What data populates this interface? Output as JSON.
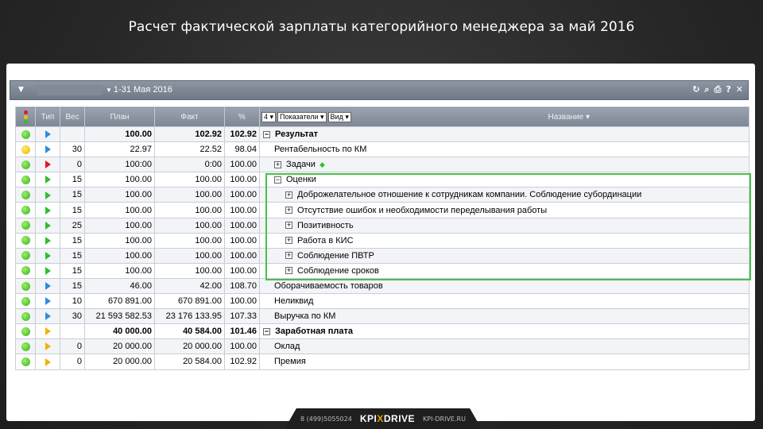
{
  "title": "Расчет фактической зарплаты категорийного менеджера за май 2016",
  "toolbar": {
    "dropdown_icon": "chevron-down-icon",
    "period_arrow": "▼",
    "period": "1-31 Мая 2016",
    "icons": [
      "refresh-icon",
      "search-icon",
      "print-icon",
      "help-icon",
      "close-icon"
    ]
  },
  "columns": {
    "type": "Тип",
    "weight": "Вес",
    "plan": "План",
    "fact": "Факт",
    "percent": "%",
    "levels": "4",
    "indicators": "Показатели",
    "view": "Вид",
    "name": "Название"
  },
  "rows": [
    {
      "light": "green",
      "type": "blue",
      "weight": "",
      "plan": "100.00",
      "fact": "102.92",
      "percent": "102.92",
      "name": "Результат",
      "indent": 0,
      "expander": "⊟",
      "bold": true
    },
    {
      "light": "yellow",
      "type": "blue",
      "weight": "30",
      "plan": "22.97",
      "fact": "22.52",
      "percent": "98.04",
      "name": "Рентабельность по КМ",
      "indent": 1,
      "expander": "",
      "bold": false
    },
    {
      "light": "green",
      "type": "red",
      "weight": "0",
      "plan": "100:00",
      "fact": "0:00",
      "percent": "100.00",
      "name": "Задачи",
      "indent": 1,
      "expander": "⊞",
      "bold": false,
      "diamond": true
    },
    {
      "light": "green",
      "type": "green",
      "weight": "15",
      "plan": "100.00",
      "fact": "100.00",
      "percent": "100.00",
      "name": "Оценки",
      "indent": 1,
      "expander": "⊟",
      "bold": false
    },
    {
      "light": "green",
      "type": "green",
      "weight": "15",
      "plan": "100.00",
      "fact": "100.00",
      "percent": "100.00",
      "name": "Доброжелательное отношение к сотрудникам компании. Соблюдение субординации",
      "indent": 2,
      "expander": "⊞",
      "bold": false
    },
    {
      "light": "green",
      "type": "green",
      "weight": "15",
      "plan": "100.00",
      "fact": "100.00",
      "percent": "100.00",
      "name": "Отсутствие ошибок и необходимости переделывания работы",
      "indent": 2,
      "expander": "⊞",
      "bold": false
    },
    {
      "light": "green",
      "type": "green",
      "weight": "25",
      "plan": "100.00",
      "fact": "100.00",
      "percent": "100.00",
      "name": "Позитивность",
      "indent": 2,
      "expander": "⊞",
      "bold": false
    },
    {
      "light": "green",
      "type": "green",
      "weight": "15",
      "plan": "100.00",
      "fact": "100.00",
      "percent": "100.00",
      "name": "Работа в КИС",
      "indent": 2,
      "expander": "⊞",
      "bold": false
    },
    {
      "light": "green",
      "type": "green",
      "weight": "15",
      "plan": "100.00",
      "fact": "100.00",
      "percent": "100.00",
      "name": "Соблюдение ПВТР",
      "indent": 2,
      "expander": "⊞",
      "bold": false
    },
    {
      "light": "green",
      "type": "green",
      "weight": "15",
      "plan": "100.00",
      "fact": "100.00",
      "percent": "100.00",
      "name": "Соблюдение сроков",
      "indent": 2,
      "expander": "⊞",
      "bold": false
    },
    {
      "light": "green",
      "type": "blue",
      "weight": "15",
      "plan": "46.00",
      "fact": "42.00",
      "percent": "108.70",
      "name": "Оборачиваемость товаров",
      "indent": 1,
      "expander": "",
      "bold": false
    },
    {
      "light": "green",
      "type": "blue",
      "weight": "10",
      "plan": "670 891.00",
      "fact": "670 891.00",
      "percent": "100.00",
      "name": "Неликвид",
      "indent": 1,
      "expander": "",
      "bold": false
    },
    {
      "light": "green",
      "type": "blue",
      "weight": "30",
      "plan": "21 593 582.53",
      "fact": "23 176 133.95",
      "percent": "107.33",
      "name": "Выручка по КМ",
      "indent": 1,
      "expander": "",
      "bold": false
    },
    {
      "light": "green",
      "type": "yellow",
      "weight": "",
      "plan": "40 000.00",
      "fact": "40 584.00",
      "percent": "101.46",
      "name": "Заработная плата",
      "indent": 0,
      "expander": "⊟",
      "bold": true
    },
    {
      "light": "green",
      "type": "yellow",
      "weight": "0",
      "plan": "20 000.00",
      "fact": "20 000.00",
      "percent": "100.00",
      "name": "Оклад",
      "indent": 1,
      "expander": "",
      "bold": false
    },
    {
      "light": "green",
      "type": "yellow",
      "weight": "0",
      "plan": "20 000.00",
      "fact": "20 584.00",
      "percent": "102.92",
      "name": "Премия",
      "indent": 1,
      "expander": "",
      "bold": false
    }
  ],
  "footer": {
    "phone": "8 (499)5055024",
    "logo_left": "KPI",
    "logo_x": "X",
    "logo_right": "DRIVE",
    "site": "KPI-DRIVE.RU"
  },
  "colors": {
    "highlight_border": "#49c04a",
    "header_bg": "#8a93a0",
    "background": "#262626"
  }
}
